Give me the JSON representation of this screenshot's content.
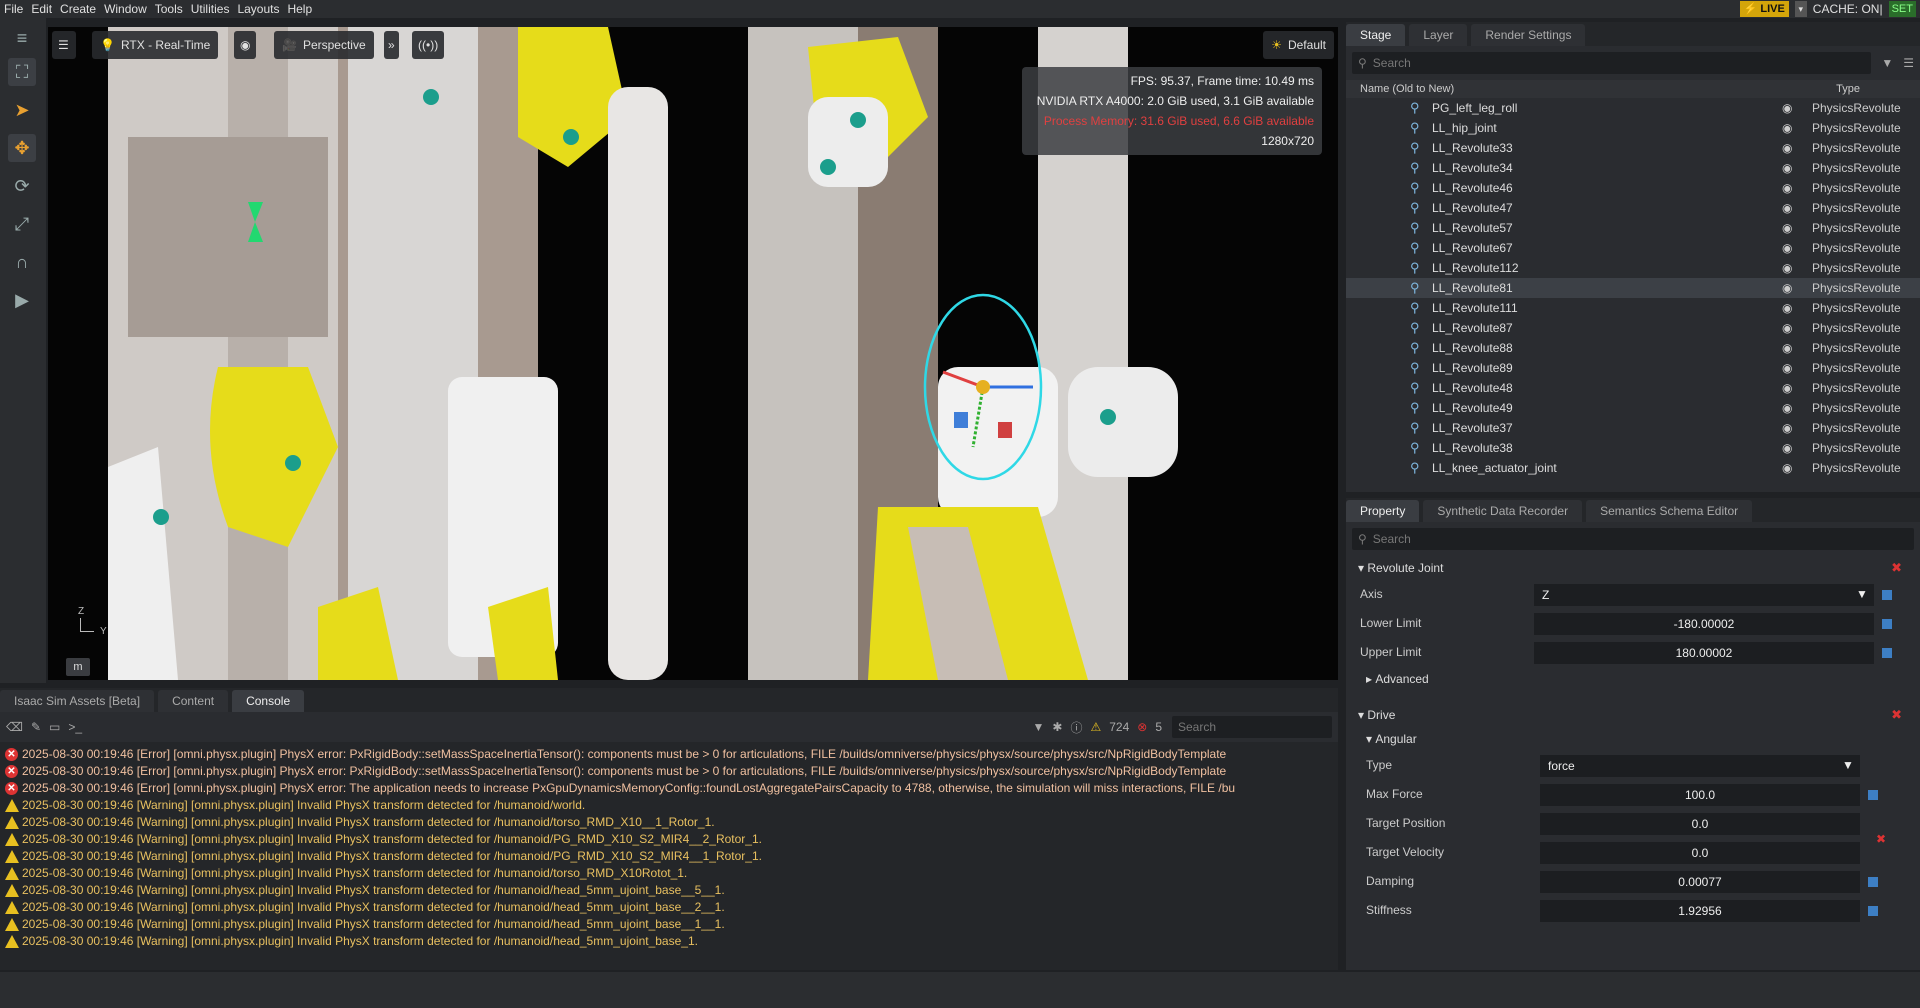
{
  "menu": [
    "File",
    "Edit",
    "Create",
    "Window",
    "Tools",
    "Utilities",
    "Layouts",
    "Help"
  ],
  "status": {
    "live": "LIVE",
    "cache": "CACHE: ON|",
    "set": "SET"
  },
  "viewport": {
    "render_mode": "RTX - Real-Time",
    "camera": "Perspective",
    "lighting": "Default",
    "stats": {
      "fps": "FPS: 95.37, Frame time: 10.49 ms",
      "gpu": "NVIDIA RTX A4000: 2.0 GiB used, 3.1 GiB available",
      "memory": "Process Memory: 31.6 GiB used, 6.6 GiB available",
      "resolution": "1280x720"
    },
    "axis_z": "Z",
    "axis_y": "Y",
    "unit": "m"
  },
  "stage": {
    "tabs": [
      "Stage",
      "Layer",
      "Render Settings"
    ],
    "search_placeholder": "Search",
    "col_name": "Name (Old to New)",
    "col_type": "Type",
    "rows": [
      {
        "name": "PG_left_leg_roll",
        "type": "PhysicsRevolute"
      },
      {
        "name": "LL_hip_joint",
        "type": "PhysicsRevolute"
      },
      {
        "name": "LL_Revolute33",
        "type": "PhysicsRevolute"
      },
      {
        "name": "LL_Revolute34",
        "type": "PhysicsRevolute"
      },
      {
        "name": "LL_Revolute46",
        "type": "PhysicsRevolute"
      },
      {
        "name": "LL_Revolute47",
        "type": "PhysicsRevolute"
      },
      {
        "name": "LL_Revolute57",
        "type": "PhysicsRevolute"
      },
      {
        "name": "LL_Revolute67",
        "type": "PhysicsRevolute"
      },
      {
        "name": "LL_Revolute112",
        "type": "PhysicsRevolute"
      },
      {
        "name": "LL_Revolute81",
        "type": "PhysicsRevolute",
        "selected": true
      },
      {
        "name": "LL_Revolute111",
        "type": "PhysicsRevolute"
      },
      {
        "name": "LL_Revolute87",
        "type": "PhysicsRevolute"
      },
      {
        "name": "LL_Revolute88",
        "type": "PhysicsRevolute"
      },
      {
        "name": "LL_Revolute89",
        "type": "PhysicsRevolute"
      },
      {
        "name": "LL_Revolute48",
        "type": "PhysicsRevolute"
      },
      {
        "name": "LL_Revolute49",
        "type": "PhysicsRevolute"
      },
      {
        "name": "LL_Revolute37",
        "type": "PhysicsRevolute"
      },
      {
        "name": "LL_Revolute38",
        "type": "PhysicsRevolute"
      },
      {
        "name": "LL_knee_actuator_joint",
        "type": "PhysicsRevolute"
      }
    ]
  },
  "property": {
    "tabs": [
      "Property",
      "Synthetic Data Recorder",
      "Semantics Schema Editor"
    ],
    "search_placeholder": "Search",
    "revolute": {
      "title": "Revolute Joint",
      "axis_label": "Axis",
      "axis_value": "Z",
      "lower_label": "Lower Limit",
      "lower_value": "-180.00002",
      "upper_label": "Upper Limit",
      "upper_value": "180.00002",
      "advanced": "Advanced"
    },
    "drive": {
      "title": "Drive",
      "angular": "Angular",
      "type_label": "Type",
      "type_value": "force",
      "maxforce_label": "Max Force",
      "maxforce_value": "100.0",
      "tpos_label": "Target Position",
      "tpos_value": "0.0",
      "tvel_label": "Target Velocity",
      "tvel_value": "0.0",
      "damping_label": "Damping",
      "damping_value": "0.00077",
      "stiffness_label": "Stiffness",
      "stiffness_value": "1.92956"
    }
  },
  "console": {
    "tabs": [
      "Isaac Sim Assets [Beta]",
      "Content",
      "Console"
    ],
    "warn_count": "724",
    "err_count": "5",
    "search_placeholder": "Search",
    "prompt": ">_",
    "lines": [
      {
        "level": "err",
        "text": "2025-08-30 00:19:46  [Error] [omni.physx.plugin] PhysX error: PxRigidBody::setMassSpaceInertiaTensor(): components must be > 0 for articulations, FILE /builds/omniverse/physics/physx/source/physx/src/NpRigidBodyTemplate"
      },
      {
        "level": "err",
        "text": "2025-08-30 00:19:46  [Error] [omni.physx.plugin] PhysX error: PxRigidBody::setMassSpaceInertiaTensor(): components must be > 0 for articulations, FILE /builds/omniverse/physics/physx/source/physx/src/NpRigidBodyTemplate"
      },
      {
        "level": "err",
        "text": "2025-08-30 00:19:46  [Error] [omni.physx.plugin] PhysX error: The application needs to increase PxGpuDynamicsMemoryConfig::foundLostAggregatePairsCapacity to 4788, otherwise, the simulation will miss interactions, FILE /bu"
      },
      {
        "level": "warn",
        "text": "2025-08-30 00:19:46  [Warning] [omni.physx.plugin] Invalid PhysX transform detected for /humanoid/world."
      },
      {
        "level": "warn",
        "text": "2025-08-30 00:19:46  [Warning] [omni.physx.plugin] Invalid PhysX transform detected for /humanoid/torso_RMD_X10__1_Rotor_1."
      },
      {
        "level": "warn",
        "text": "2025-08-30 00:19:46  [Warning] [omni.physx.plugin] Invalid PhysX transform detected for /humanoid/PG_RMD_X10_S2_MIR4__2_Rotor_1."
      },
      {
        "level": "warn",
        "text": "2025-08-30 00:19:46  [Warning] [omni.physx.plugin] Invalid PhysX transform detected for /humanoid/PG_RMD_X10_S2_MIR4__1_Rotor_1."
      },
      {
        "level": "warn",
        "text": "2025-08-30 00:19:46  [Warning] [omni.physx.plugin] Invalid PhysX transform detected for /humanoid/torso_RMD_X10Rotot_1."
      },
      {
        "level": "warn",
        "text": "2025-08-30 00:19:46  [Warning] [omni.physx.plugin] Invalid PhysX transform detected for /humanoid/head_5mm_ujoint_base__5__1."
      },
      {
        "level": "warn",
        "text": "2025-08-30 00:19:46  [Warning] [omni.physx.plugin] Invalid PhysX transform detected for /humanoid/head_5mm_ujoint_base__2__1."
      },
      {
        "level": "warn",
        "text": "2025-08-30 00:19:46  [Warning] [omni.physx.plugin] Invalid PhysX transform detected for /humanoid/head_5mm_ujoint_base__1__1."
      },
      {
        "level": "warn",
        "text": "2025-08-30 00:19:46  [Warning] [omni.physx.plugin] Invalid PhysX transform detected for /humanoid/head_5mm_ujoint_base_1."
      }
    ]
  }
}
